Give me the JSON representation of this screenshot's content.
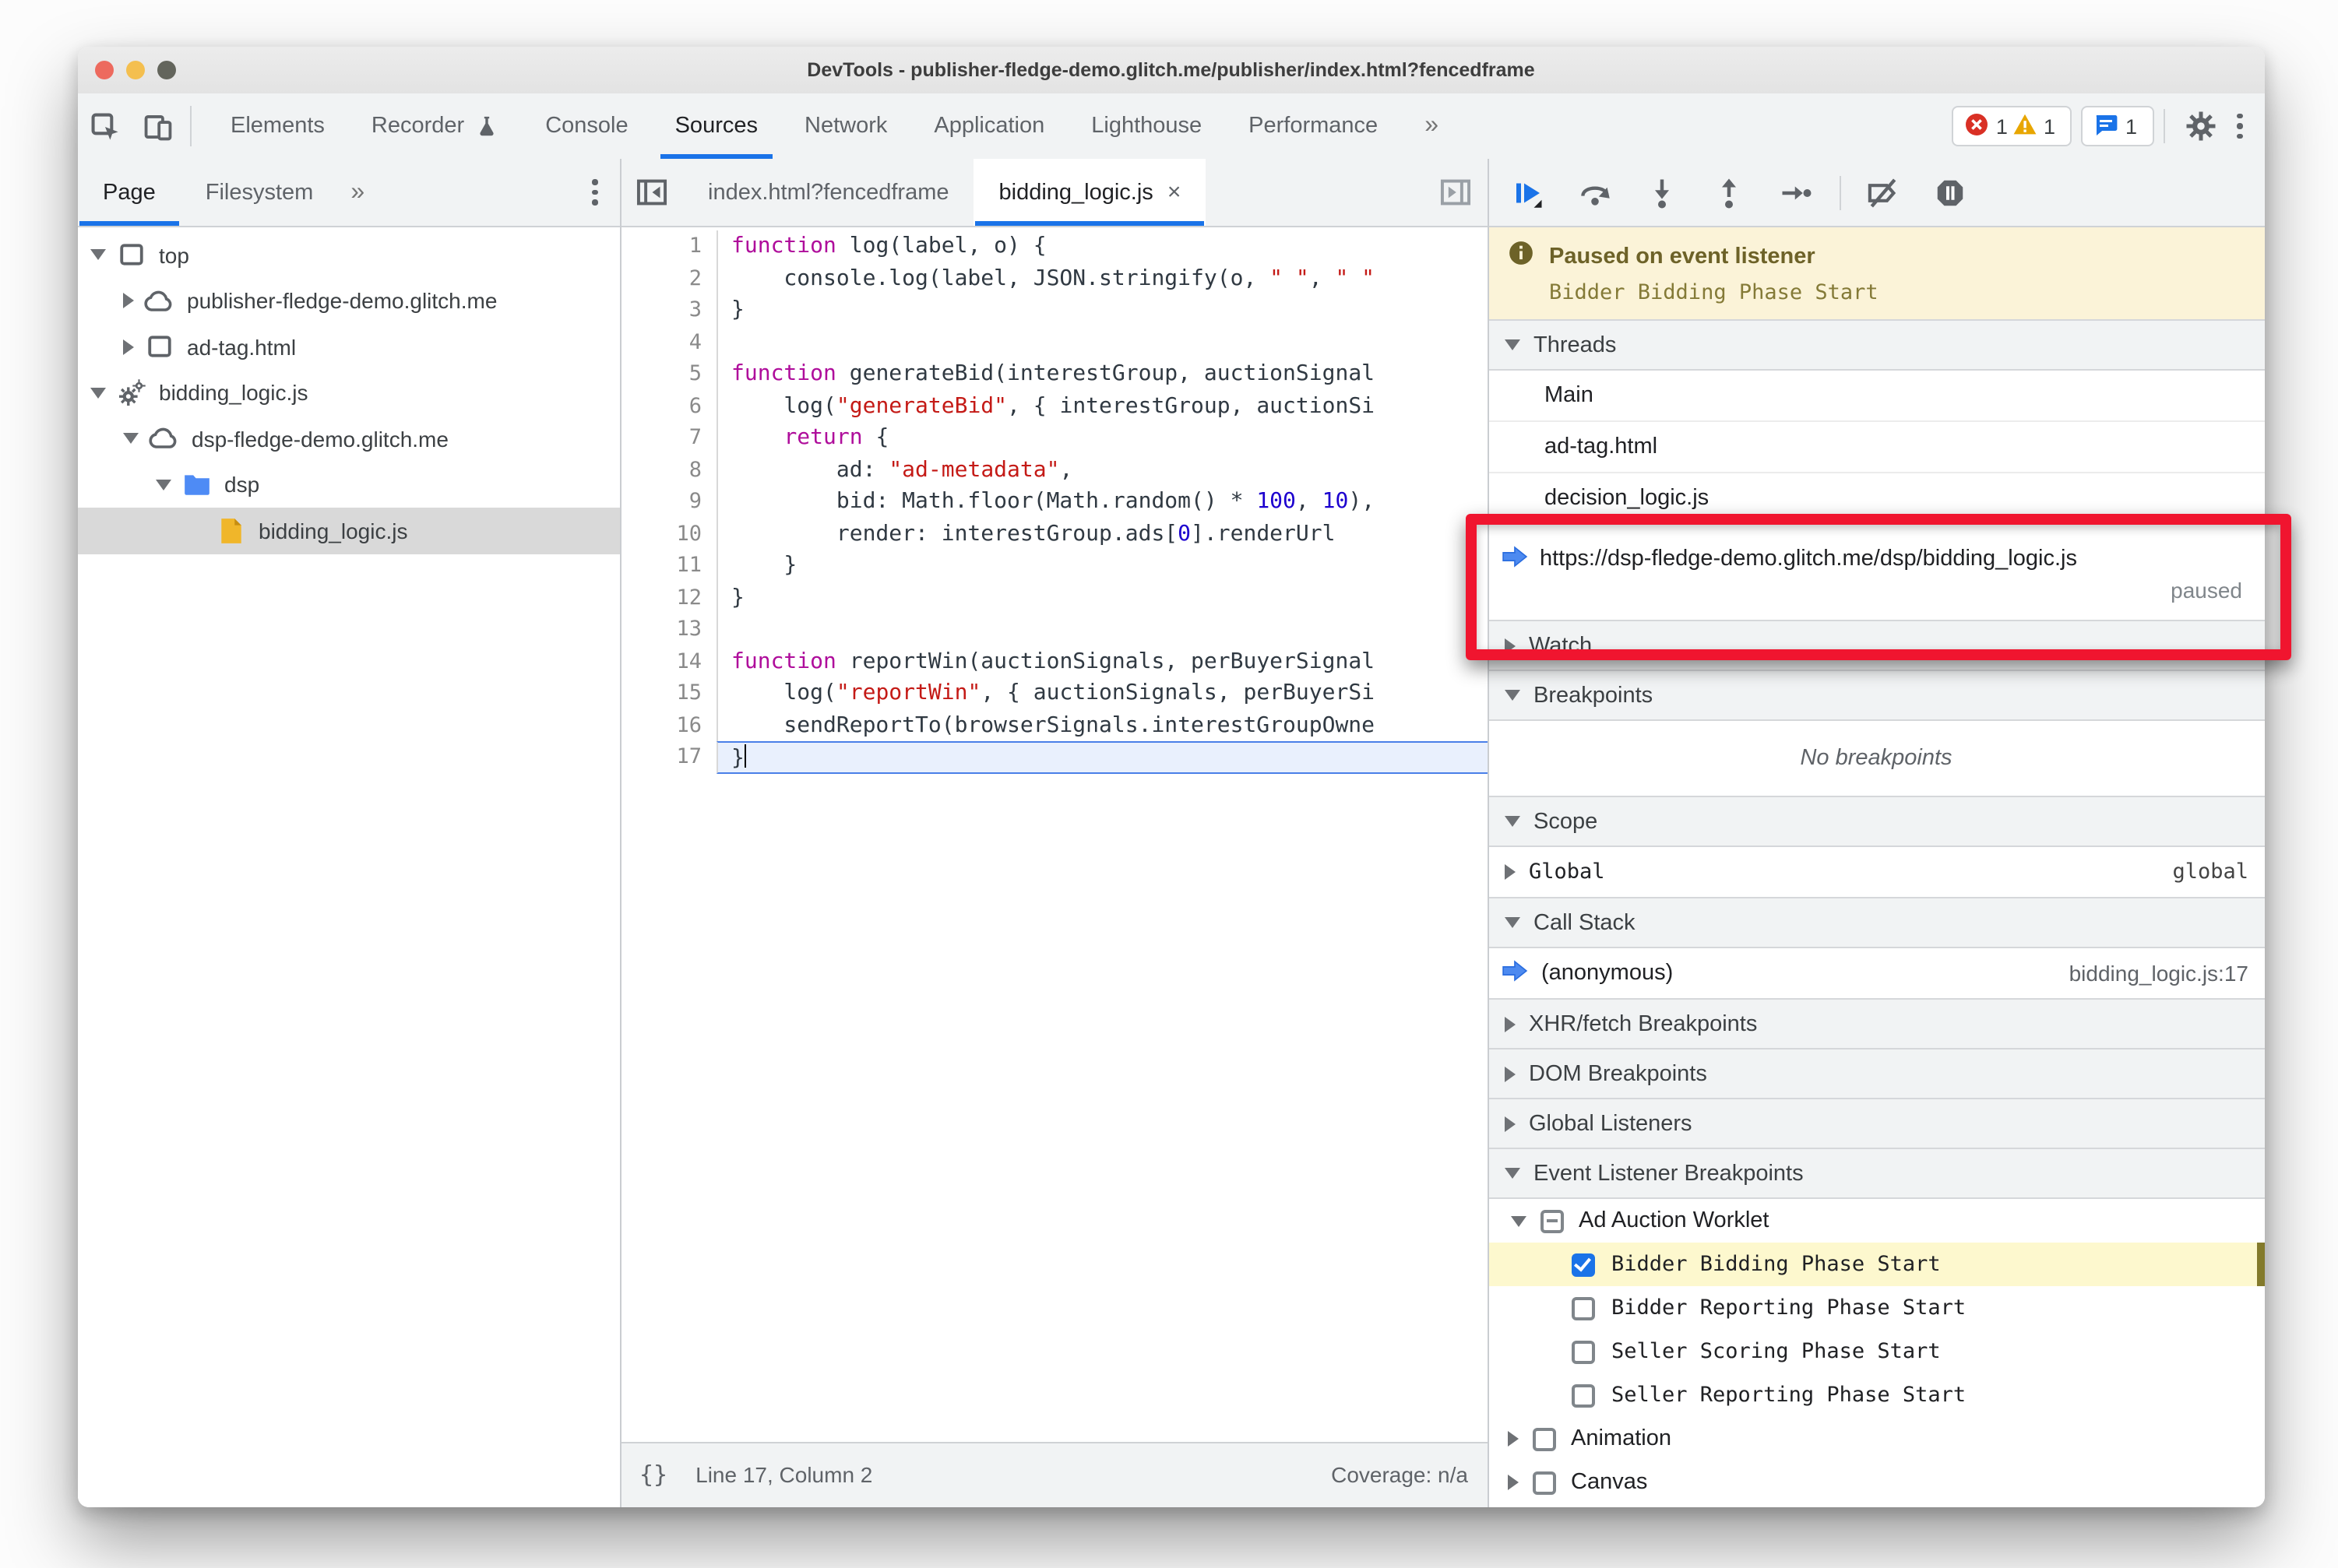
{
  "window": {
    "title": "DevTools - publisher-fledge-demo.glitch.me/publisher/index.html?fencedframe"
  },
  "colors": {
    "accent_blue": "#1a73e8",
    "annotation_red": "#f0152f",
    "paused_banner_bg": "#fbf3d8",
    "selected_row_gray": "#d9d9d9",
    "breakpoint_highlight_yellow": "#fdf8ce",
    "keyword": "#af0d9b",
    "string": "#c41a16",
    "number": "#1c00cf"
  },
  "toolbar": {
    "tabs": [
      "Elements",
      "Recorder",
      "Console",
      "Sources",
      "Network",
      "Application",
      "Lighthouse",
      "Performance"
    ],
    "active_tab": "Sources",
    "more_tabs_label": "»",
    "error_count": "1",
    "warning_count": "1",
    "message_count": "1"
  },
  "sidebar": {
    "tabs": [
      "Page",
      "Filesystem"
    ],
    "active_tab": "Page",
    "more_label": "»",
    "tree": [
      {
        "label": "top",
        "icon": "frame-icon",
        "depth": 0,
        "expander": "expanded",
        "selected": false
      },
      {
        "label": "publisher-fledge-demo.glitch.me",
        "icon": "cloud-icon",
        "depth": 1,
        "expander": "collapsed",
        "selected": false
      },
      {
        "label": "ad-tag.html",
        "icon": "frame-icon",
        "depth": 1,
        "expander": "collapsed",
        "selected": false
      },
      {
        "label": "bidding_logic.js",
        "icon": "worker-icon",
        "depth": 0,
        "expander": "expanded",
        "selected": false
      },
      {
        "label": "dsp-fledge-demo.glitch.me",
        "icon": "cloud-icon",
        "depth": 1,
        "expander": "expanded",
        "selected": false
      },
      {
        "label": "dsp",
        "icon": "folder-icon",
        "depth": 2,
        "expander": "expanded",
        "selected": false
      },
      {
        "label": "bidding_logic.js",
        "icon": "js-file-icon",
        "depth": 3,
        "expander": "none",
        "selected": true
      }
    ]
  },
  "editor": {
    "tabs": [
      {
        "label": "index.html?fencedframe",
        "active": false,
        "closable": false
      },
      {
        "label": "bidding_logic.js",
        "active": true,
        "closable": true
      }
    ],
    "close_glyph": "×",
    "lines": [
      {
        "n": "1",
        "tokens": [
          [
            "kw",
            "function"
          ],
          [
            "pl",
            " log(label, o) {"
          ]
        ]
      },
      {
        "n": "2",
        "tokens": [
          [
            "pl",
            "    console.log(label, JSON.stringify(o, "
          ],
          [
            "str",
            "\" \""
          ],
          [
            "pl",
            ", "
          ],
          [
            "str",
            "\" \""
          ]
        ]
      },
      {
        "n": "3",
        "tokens": [
          [
            "pl",
            "}"
          ]
        ]
      },
      {
        "n": "4",
        "tokens": []
      },
      {
        "n": "5",
        "tokens": [
          [
            "kw",
            "function"
          ],
          [
            "pl",
            " generateBid(interestGroup, auctionSignal"
          ]
        ]
      },
      {
        "n": "6",
        "tokens": [
          [
            "pl",
            "    log("
          ],
          [
            "str",
            "\"generateBid\""
          ],
          [
            "pl",
            ", { interestGroup, auctionSi"
          ]
        ]
      },
      {
        "n": "7",
        "tokens": [
          [
            "pl",
            "    "
          ],
          [
            "kw",
            "return"
          ],
          [
            "pl",
            " {"
          ]
        ]
      },
      {
        "n": "8",
        "tokens": [
          [
            "pl",
            "        ad: "
          ],
          [
            "str",
            "\"ad-metadata\""
          ],
          [
            "pl",
            ","
          ]
        ]
      },
      {
        "n": "9",
        "tokens": [
          [
            "pl",
            "        bid: Math.floor(Math.random() * "
          ],
          [
            "num",
            "100"
          ],
          [
            "pl",
            ", "
          ],
          [
            "num",
            "10"
          ],
          [
            "pl",
            "),"
          ]
        ]
      },
      {
        "n": "10",
        "tokens": [
          [
            "pl",
            "        render: interestGroup.ads["
          ],
          [
            "num",
            "0"
          ],
          [
            "pl",
            "].renderUrl"
          ]
        ]
      },
      {
        "n": "11",
        "tokens": [
          [
            "pl",
            "    }"
          ]
        ]
      },
      {
        "n": "12",
        "tokens": [
          [
            "pl",
            "}"
          ]
        ]
      },
      {
        "n": "13",
        "tokens": []
      },
      {
        "n": "14",
        "tokens": [
          [
            "kw",
            "function"
          ],
          [
            "pl",
            " reportWin(auctionSignals, perBuyerSignal"
          ]
        ]
      },
      {
        "n": "15",
        "tokens": [
          [
            "pl",
            "    log("
          ],
          [
            "str",
            "\"reportWin\""
          ],
          [
            "pl",
            ", { auctionSignals, perBuyerSi"
          ]
        ]
      },
      {
        "n": "16",
        "tokens": [
          [
            "pl",
            "    sendReportTo(browserSignals.interestGroupOwne"
          ]
        ]
      },
      {
        "n": "17",
        "tokens": [
          [
            "pl",
            "}"
          ]
        ],
        "highlighted": true,
        "caret": true
      }
    ],
    "status": {
      "pretty_print": "{}",
      "line_col": "Line 17, Column 2",
      "coverage": "Coverage: n/a"
    }
  },
  "debugger": {
    "buttons": [
      "resume",
      "step-over",
      "step-into",
      "step-out",
      "step",
      "sep",
      "deactivate-breakpoints",
      "pause-on-exceptions"
    ],
    "banner": {
      "title": "Paused on event listener",
      "subtitle": "Bidder Bidding Phase Start"
    },
    "sections": [
      {
        "type": "hdr",
        "label": "Threads",
        "arrow": "expanded"
      },
      {
        "type": "row",
        "label": "Main"
      },
      {
        "type": "row",
        "label": "ad-tag.html"
      },
      {
        "type": "row",
        "label": "decision_logic.js"
      },
      {
        "type": "thread",
        "label": "https://dsp-fledge-demo.glitch.me/dsp/bidding_logic.js",
        "status": "paused",
        "marker": true
      },
      {
        "type": "hdr",
        "label": "Watch",
        "arrow": "collapsed"
      },
      {
        "type": "hdr",
        "label": "Breakpoints",
        "arrow": "expanded"
      },
      {
        "type": "empty",
        "label": "No breakpoints"
      },
      {
        "type": "hdr",
        "label": "Scope",
        "arrow": "expanded"
      },
      {
        "type": "scope",
        "label": "Global",
        "value": "global",
        "arrow": "collapsed"
      },
      {
        "type": "hdr",
        "label": "Call Stack",
        "arrow": "expanded"
      },
      {
        "type": "frame",
        "label": "(anonymous)",
        "value": "bidding_logic.js:17",
        "marker": true
      },
      {
        "type": "hdr",
        "label": "XHR/fetch Breakpoints",
        "arrow": "collapsed"
      },
      {
        "type": "hdr",
        "label": "DOM Breakpoints",
        "arrow": "collapsed"
      },
      {
        "type": "hdr",
        "label": "Global Listeners",
        "arrow": "collapsed"
      },
      {
        "type": "hdr",
        "label": "Event Listener Breakpoints",
        "arrow": "expanded"
      },
      {
        "type": "elgroup",
        "label": "Ad Auction Worklet",
        "checkbox": "indeterminate",
        "arrow": "expanded"
      },
      {
        "type": "elitem",
        "label": "Bidder Bidding Phase Start",
        "checkbox": "checked",
        "highlighted": true
      },
      {
        "type": "elitem",
        "label": "Bidder Reporting Phase Start",
        "checkbox": "unchecked"
      },
      {
        "type": "elitem",
        "label": "Seller Scoring Phase Start",
        "checkbox": "unchecked"
      },
      {
        "type": "elitem",
        "label": "Seller Reporting Phase Start",
        "checkbox": "unchecked"
      },
      {
        "type": "elroot",
        "label": "Animation",
        "checkbox": "unchecked",
        "arrow": "collapsed"
      },
      {
        "type": "elroot",
        "label": "Canvas",
        "checkbox": "unchecked",
        "arrow": "collapsed"
      }
    ]
  },
  "annotation": {
    "description": "red highlight rectangle around paused worklet thread"
  }
}
